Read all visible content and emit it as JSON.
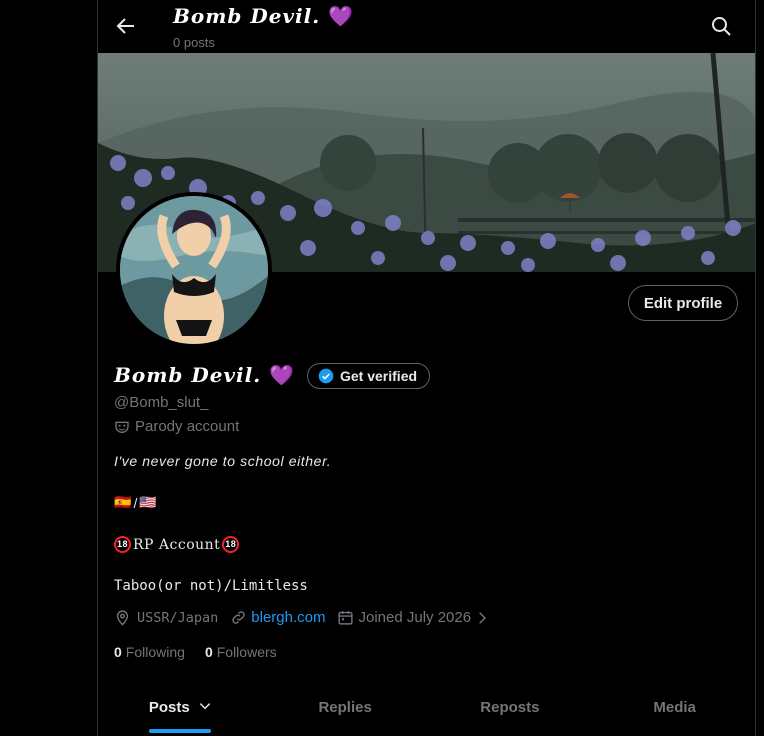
{
  "header": {
    "name": "Bomb Devil.",
    "name_emoji": "💜",
    "posts_count": "0 posts"
  },
  "profile": {
    "name": "Bomb Devil.",
    "name_emoji": "💜",
    "verify_label": "Get verified",
    "handle": "@Bomb_slut_",
    "parody_label": "Parody account",
    "edit_label": "Edit profile",
    "bio": {
      "line1": "I've never gone to school either.",
      "flag1": "🇪🇸",
      "flag_sep": "/",
      "flag2": "🇺🇸",
      "line3_badge": "18",
      "line3": "RP Account",
      "line4": "Taboo(or not)/Limitless"
    },
    "location": "USSR/Japan",
    "link": "blergh.com",
    "joined": "Joined July 2026",
    "following_count": "0",
    "following_label": "Following",
    "followers_count": "0",
    "followers_label": "Followers"
  },
  "tabs": [
    {
      "label": "Posts",
      "active": true
    },
    {
      "label": "Replies",
      "active": false
    },
    {
      "label": "Reposts",
      "active": false
    },
    {
      "label": "Media",
      "active": false
    }
  ],
  "colors": {
    "accent": "#1d9bf0",
    "muted": "#71767b",
    "text": "#e7e9ea",
    "heart": "#ab8ee3"
  }
}
